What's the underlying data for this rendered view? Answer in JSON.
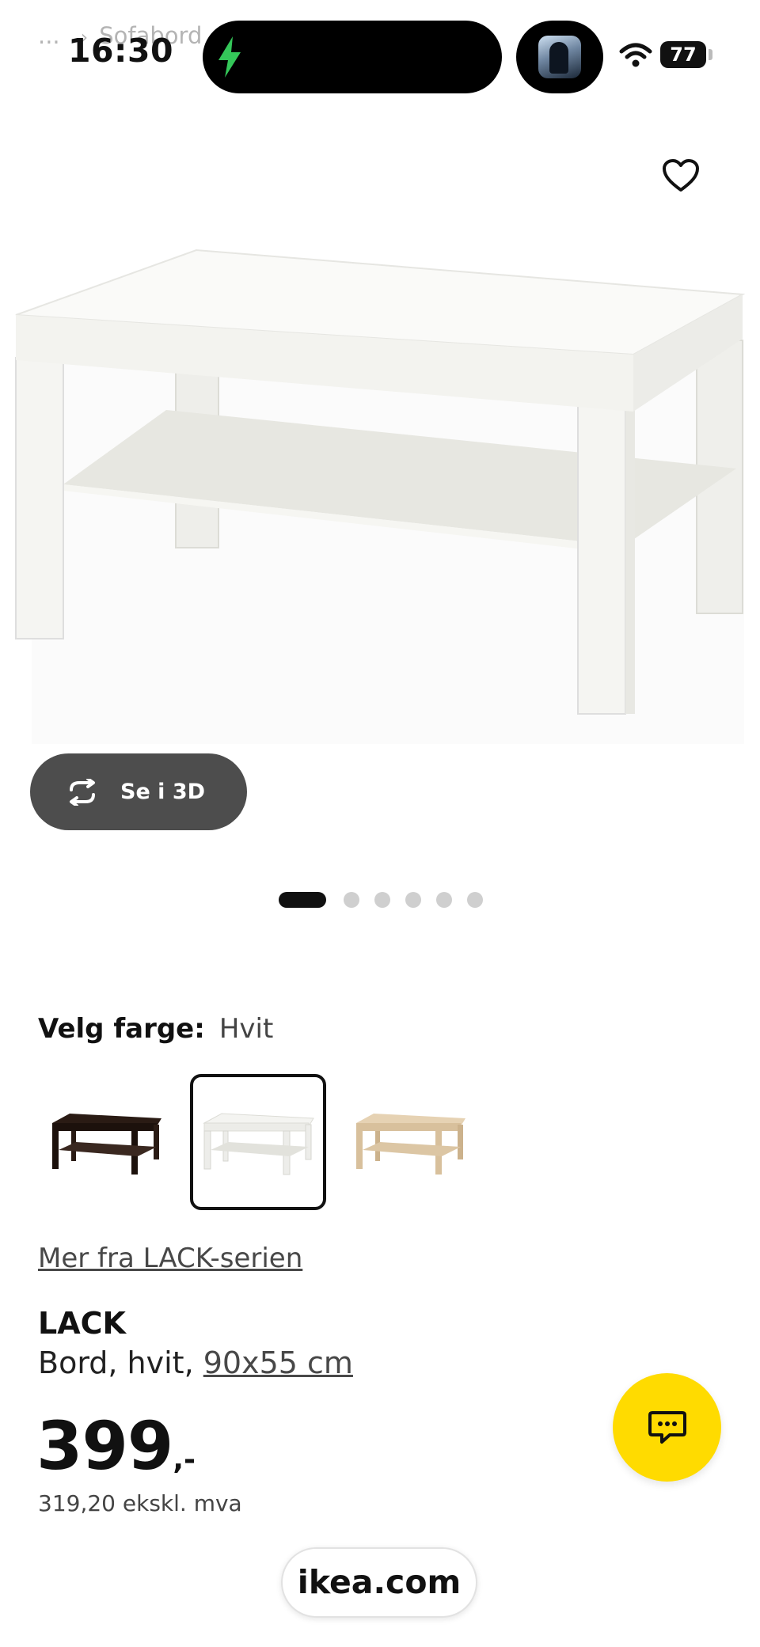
{
  "status_bar": {
    "time": "16:30",
    "battery": "77"
  },
  "breadcrumb": {
    "ellipsis": "...",
    "separator": "›",
    "current": "Sofabord"
  },
  "icons": {
    "favorite": "heart-icon",
    "rotate": "rotate-3d-icon",
    "chat": "chat-icon"
  },
  "gallery": {
    "view_3d_label": "Se i 3D",
    "dot_count": 6,
    "active_index": 0
  },
  "color_selector": {
    "label": "Velg farge:",
    "selected_value": "Hvit",
    "options": [
      "black-brown",
      "white",
      "oak-effect"
    ],
    "selected_index": 1
  },
  "series_link": "Mer fra LACK-serien",
  "product": {
    "name": "LACK",
    "description_prefix": "Bord, hvit, ",
    "size_link": "90x55 cm",
    "price": "399",
    "price_suffix": ",-",
    "price_ex_vat": "319,20 ekskl. mva"
  },
  "browser": {
    "url": "ikea.com"
  },
  "colors": {
    "accent_yellow": "#ffdb00",
    "button_dark": "#4d4d4d",
    "charge_green": "#34c759"
  }
}
